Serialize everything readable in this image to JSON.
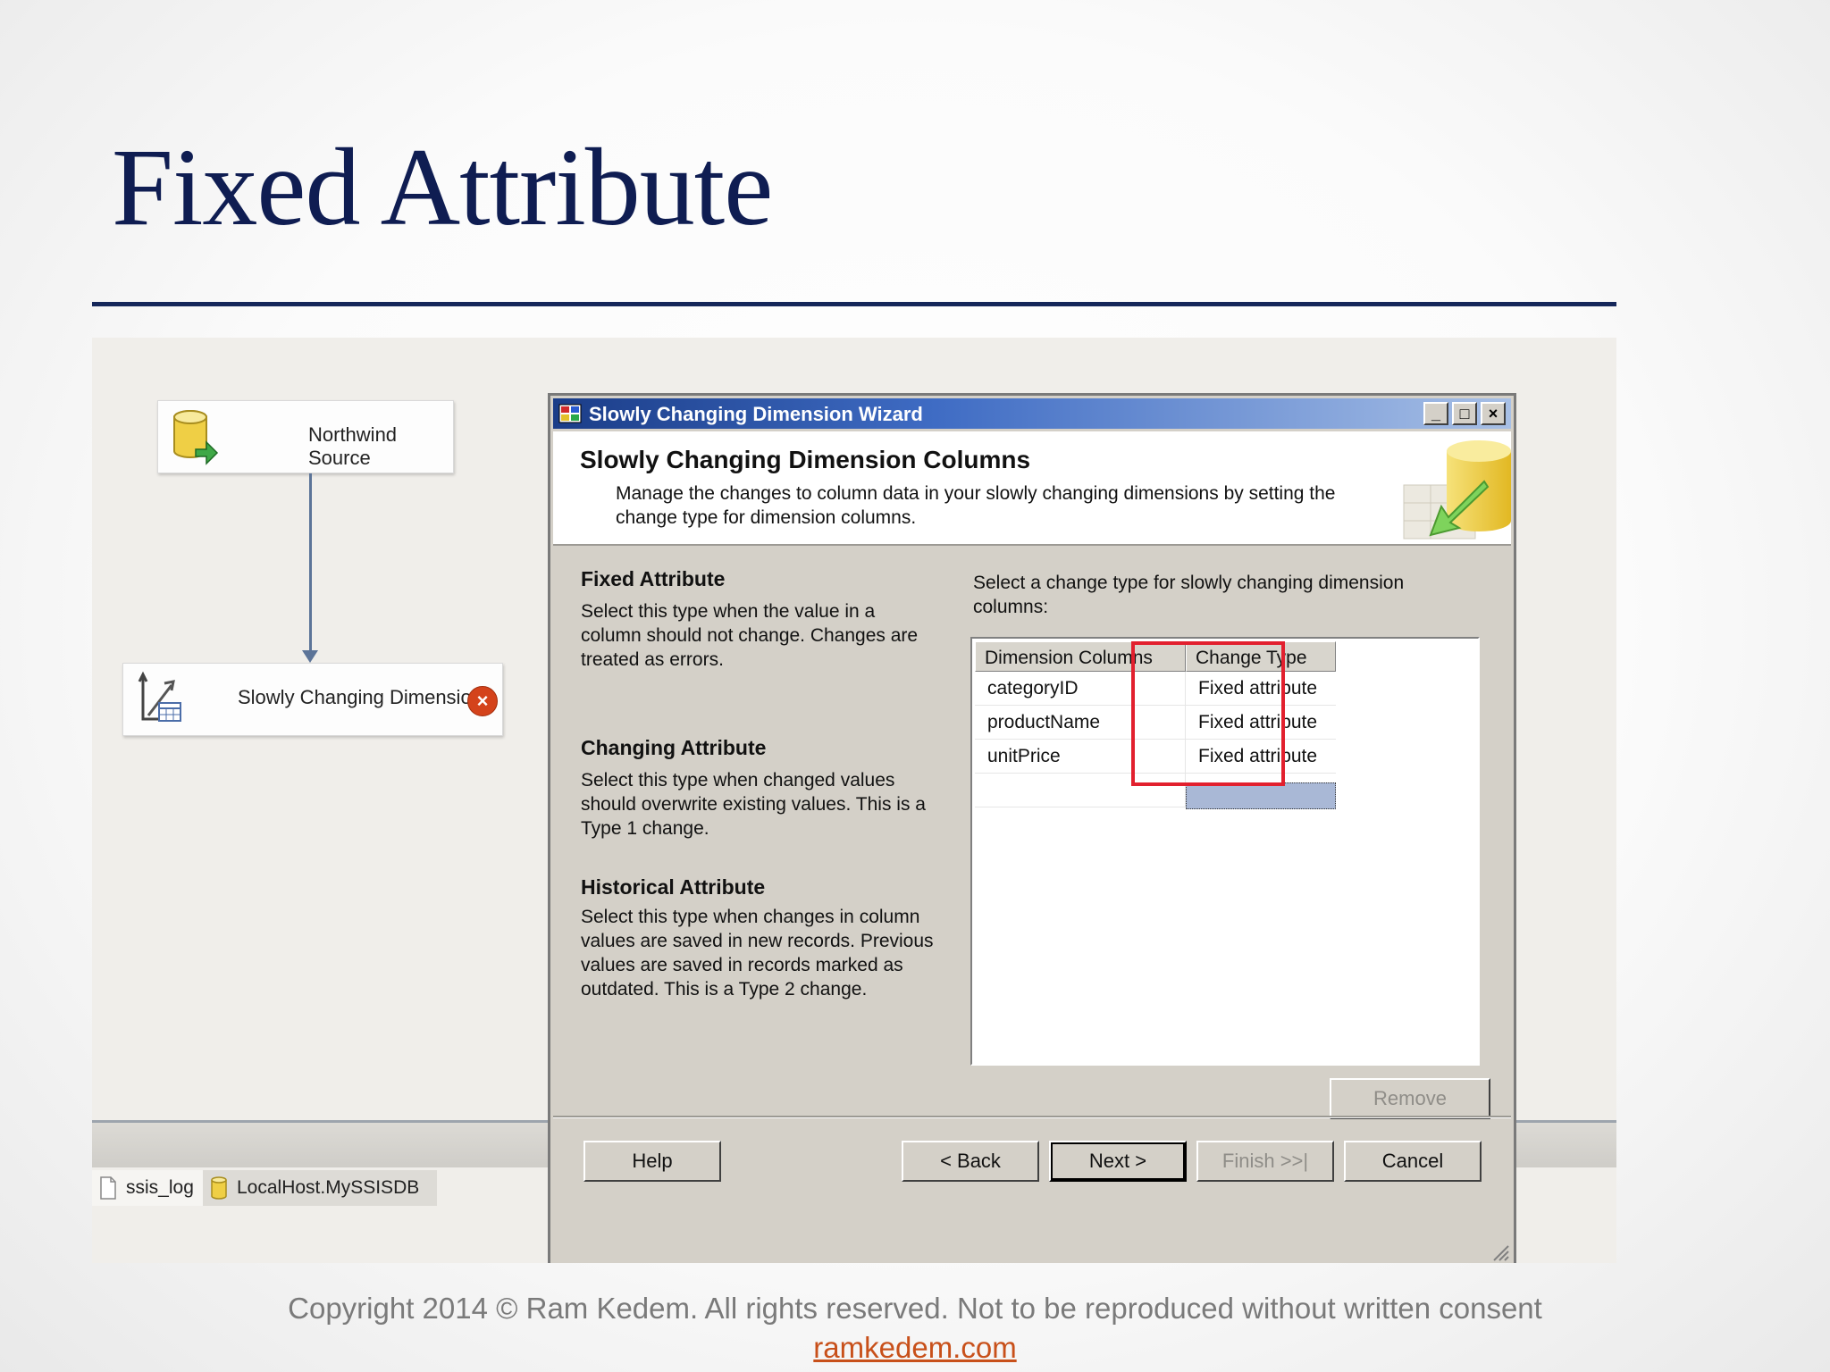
{
  "slide": {
    "title": "Fixed Attribute",
    "copyright": "Copyright 2014 © Ram Kedem. All rights reserved. Not to be reproduced without written consent",
    "link": "ramkedem.com"
  },
  "canvas": {
    "source_node": "Northwind Source",
    "scd_node": "Slowly Changing Dimension",
    "error_glyph": "×",
    "connection_tabs": [
      "ssis_log",
      "LocalHost.MySSISDB"
    ]
  },
  "wizard": {
    "window_title": "Slowly Changing Dimension Wizard",
    "window_buttons": {
      "minimize": "_",
      "maximize": "□",
      "close": "×"
    },
    "header_title": "Slowly Changing Dimension Columns",
    "header_desc": "Manage the changes to column data in your slowly changing dimensions by setting the change type for dimension columns.",
    "sections": [
      {
        "title": "Fixed Attribute",
        "desc": "Select this type when the value in a column should not change. Changes are treated as errors."
      },
      {
        "title": "Changing Attribute",
        "desc": "Select this type when changed values should overwrite existing values. This is a Type 1 change."
      },
      {
        "title": "Historical Attribute",
        "desc": "Select this type when changes in column values are saved in new records. Previous values are saved in records marked as outdated. This is a Type 2 change."
      }
    ],
    "grid_prompt": "Select a change type for slowly changing dimension columns:",
    "grid": {
      "headers": [
        "Dimension Columns",
        "Change Type"
      ],
      "rows": [
        [
          "categoryID",
          "Fixed attribute"
        ],
        [
          "productName",
          "Fixed attribute"
        ],
        [
          "unitPrice",
          "Fixed attribute"
        ]
      ]
    },
    "buttons": {
      "remove": "Remove",
      "help": "Help",
      "back": "< Back",
      "next": "Next >",
      "finish": "Finish >>|",
      "cancel": "Cancel"
    }
  },
  "colors": {
    "title": "#0f1d52",
    "highlight": "#e2202e",
    "link": "#c8501a"
  }
}
